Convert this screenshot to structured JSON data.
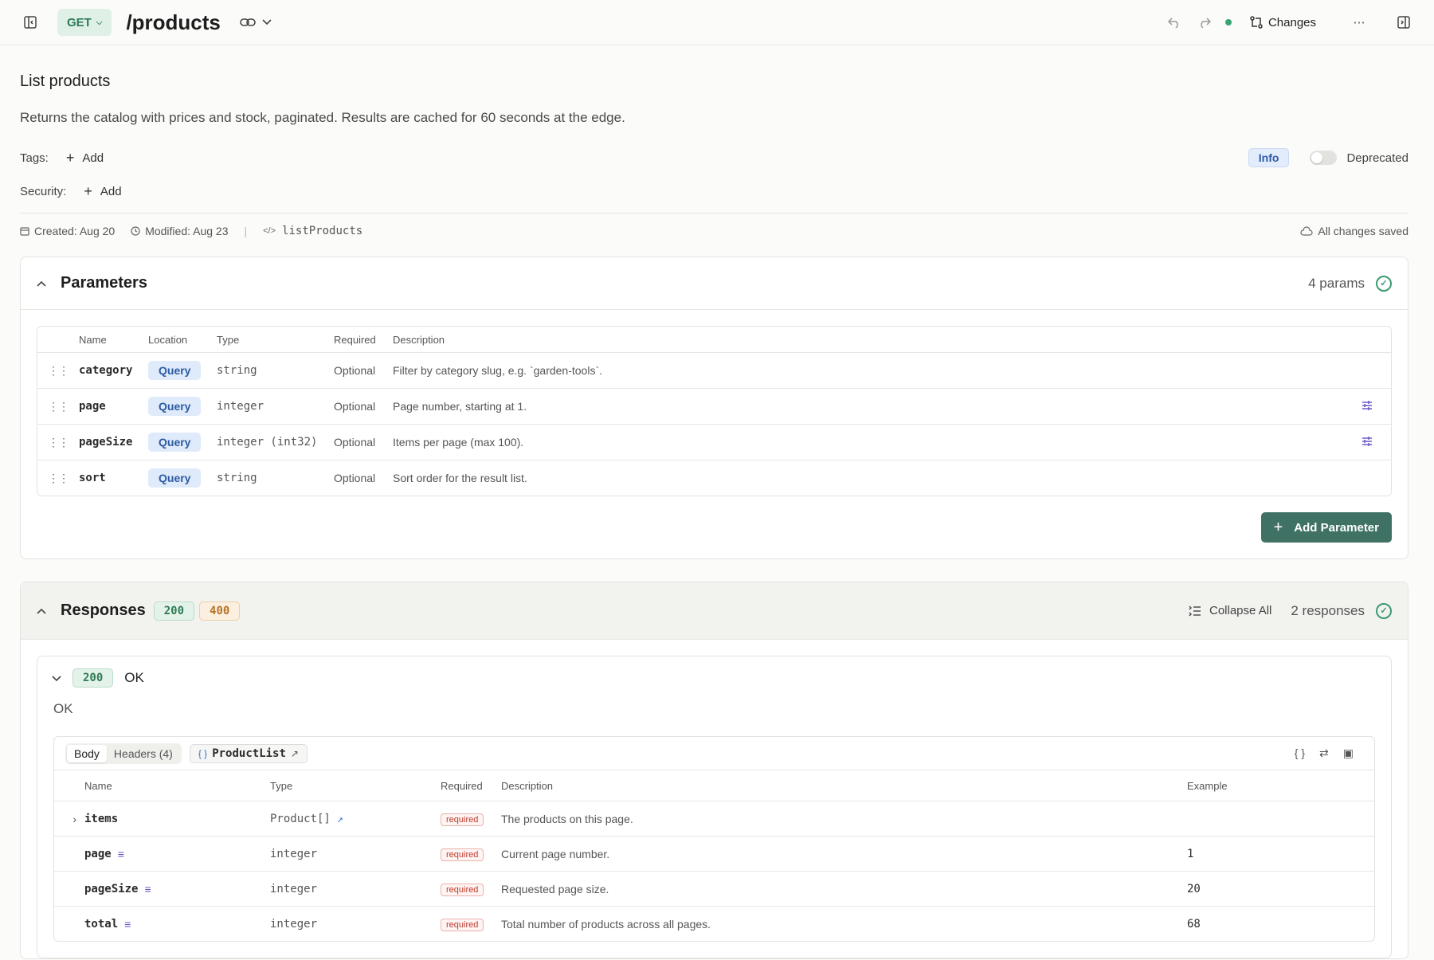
{
  "topbar": {
    "method": "GET",
    "path": "/products",
    "changes_label": "Changes"
  },
  "operation": {
    "title": "List products",
    "description": "Returns the catalog with prices and stock, paginated. Results are cached for 60 seconds at the edge.",
    "tags_label": "Tags:",
    "security_label": "Security:",
    "add_label": "Add",
    "info_badge": "Info",
    "deprecated_label": "Deprecated",
    "created": "Created: Aug 20",
    "modified": "Modified: Aug 23",
    "operation_id": "listProducts",
    "save_status": "All changes saved"
  },
  "parameters": {
    "title": "Parameters",
    "count": "4 params",
    "headers": [
      "Name",
      "Location",
      "Type",
      "Required",
      "Description"
    ],
    "rows": [
      {
        "name": "category",
        "location": "Query",
        "type": "string",
        "required": "Optional",
        "description": "Filter by category slug, e.g. `garden-tools`."
      },
      {
        "name": "page",
        "location": "Query",
        "type": "integer",
        "required": "Optional",
        "description": "Page number, starting at 1."
      },
      {
        "name": "pageSize",
        "location": "Query",
        "type": "integer (int32)",
        "required": "Optional",
        "description": "Items per page (max 100)."
      },
      {
        "name": "sort",
        "location": "Query",
        "type": "string",
        "required": "Optional",
        "description": "Sort order for the result list."
      }
    ],
    "add_button": "Add Parameter"
  },
  "responses": {
    "title": "Responses",
    "codes": [
      "200",
      "400"
    ],
    "collapse_label": "Collapse All",
    "count": "2 responses",
    "card": {
      "code": "200",
      "status_text": "OK",
      "description": "OK",
      "tabs": [
        "Body",
        "Headers (4)"
      ],
      "model": "ProductList",
      "headers": [
        "Name",
        "Type",
        "Required",
        "Description",
        "Example"
      ],
      "rows": [
        {
          "name": "items",
          "type": "Product[]",
          "required": "required",
          "description": "The products on this page.",
          "example": ""
        },
        {
          "name": "page",
          "type": "integer",
          "required": "required",
          "description": "Current page number.",
          "example": "1"
        },
        {
          "name": "pageSize",
          "type": "integer",
          "required": "required",
          "description": "Requested page size.",
          "example": "20"
        },
        {
          "name": "total",
          "type": "integer",
          "required": "required",
          "description": "Total number of products across all pages.",
          "example": "68"
        }
      ]
    }
  },
  "colors": {
    "accent_green": "#3f7264",
    "method_green": "#2f7a56",
    "query_blue": "#2c5ba3",
    "warning_orange": "#b87324",
    "required_red": "#c0392b"
  }
}
